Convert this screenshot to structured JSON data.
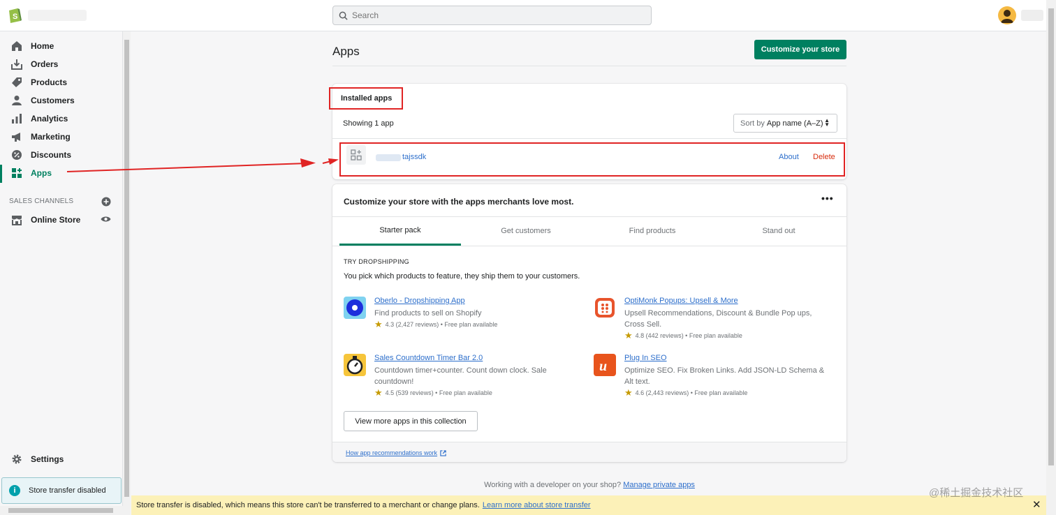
{
  "topbar": {
    "search_placeholder": "Search",
    "colors": {
      "bg": "#ffffff",
      "logo": "#95bf47"
    }
  },
  "sidebar": {
    "items": [
      {
        "label": "Home",
        "icon": "home-icon"
      },
      {
        "label": "Orders",
        "icon": "orders-icon"
      },
      {
        "label": "Products",
        "icon": "tag-icon"
      },
      {
        "label": "Customers",
        "icon": "person-icon"
      },
      {
        "label": "Analytics",
        "icon": "bar-chart-icon"
      },
      {
        "label": "Marketing",
        "icon": "megaphone-icon"
      },
      {
        "label": "Discounts",
        "icon": "discount-icon"
      },
      {
        "label": "Apps",
        "icon": "apps-icon",
        "active": true
      }
    ],
    "sales_channels_title": "SALES CHANNELS",
    "online_store": "Online Store",
    "settings": "Settings",
    "store_transfer": "Store transfer disabled",
    "active_color": "#008060"
  },
  "page": {
    "title": "Apps",
    "customize_button": "Customize your store"
  },
  "installed": {
    "title": "Installed apps",
    "showing": "Showing 1 app",
    "sort_prefix": "Sort by",
    "sort_value": "App name (A–Z)",
    "app_name": "tajssdk",
    "about": "About",
    "delete": "Delete"
  },
  "recommendations": {
    "title": "Customize your store with the apps merchants love most.",
    "tabs": [
      "Starter pack",
      "Get customers",
      "Find products",
      "Stand out"
    ],
    "section_title": "TRY DROPSHIPPING",
    "section_desc": "You pick which products to feature, they ship them to your customers.",
    "apps": [
      {
        "name": "Oberlo - Dropshipping App",
        "desc": "Find products to sell on Shopify",
        "rating": "4.3 (2,427 reviews) • Free plan available"
      },
      {
        "name": "OptiMonk Popups: Upsell & More",
        "desc": "Upsell Recommendations, Discount & Bundle Pop ups, Cross Sell.",
        "rating": "4.8 (442 reviews) • Free plan available"
      },
      {
        "name": "Sales Countdown Timer Bar 2.0",
        "desc": "Countdown timer+counter. Count down clock. Sale countdown!",
        "rating": "4.5 (539 reviews) • Free plan available"
      },
      {
        "name": "Plug In SEO",
        "desc": "Optimize SEO. Fix Broken Links. Add JSON-LD Schema & Alt text.",
        "rating": "4.6 (2,443 reviews) • Free plan available"
      }
    ],
    "view_more": "View more apps in this collection",
    "how_link": "How app recommendations work"
  },
  "footer": {
    "private_prefix": "Working with a developer on your shop?",
    "private_link": "Manage private apps"
  },
  "banner": {
    "text": "Store transfer is disabled, which means this store can't be transferred to a merchant or change plans.",
    "link": "Learn more about store transfer"
  },
  "watermark": "@稀土掘金技术社区"
}
